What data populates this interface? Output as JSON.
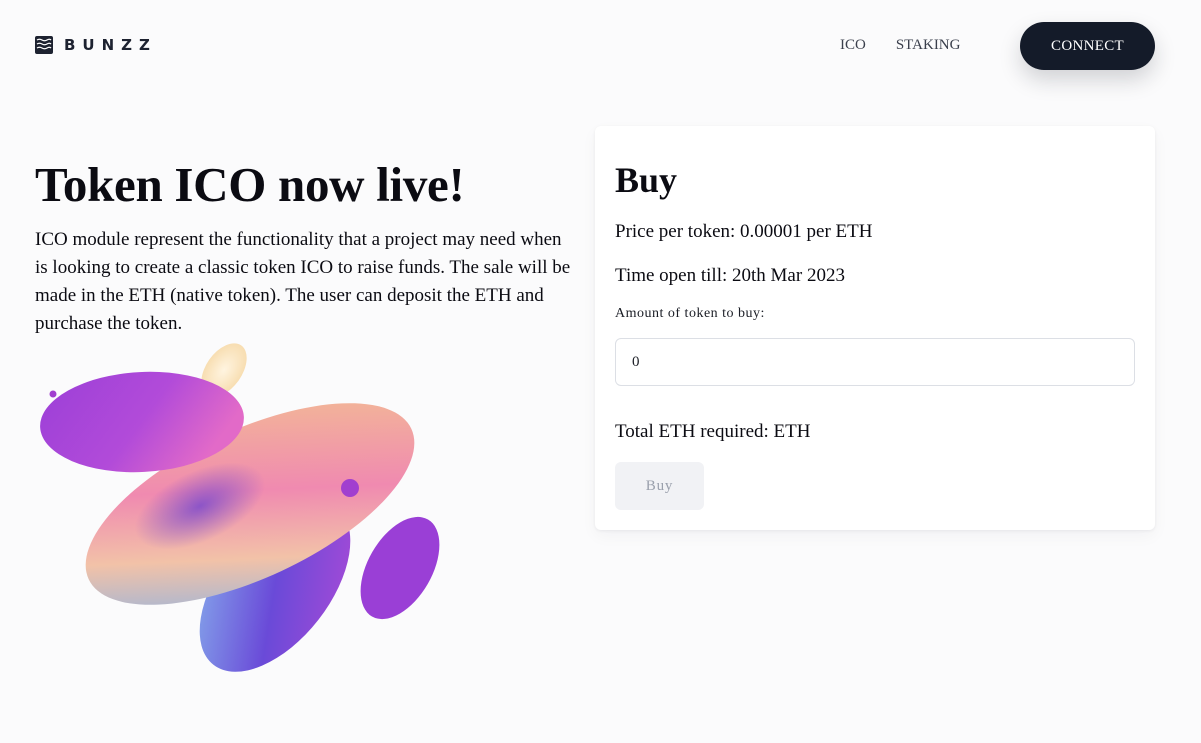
{
  "header": {
    "logo_text": "BUNZZ",
    "logo_icon": "bunzz-logo-icon",
    "nav": [
      {
        "label": "ICO"
      },
      {
        "label": "STAKING"
      }
    ],
    "connect_label": "CONNECT"
  },
  "hero": {
    "title": "Token ICO now live!",
    "description": "ICO module represent the functionality that a project may need when is looking to create a classic token ICO to raise funds. The sale will be made in the ETH (native token). The user can deposit the ETH and purchase the token.",
    "art": "abstract-gradient-shapes"
  },
  "buy_card": {
    "title": "Buy",
    "price_text": "Price per token: 0.00001 per ETH",
    "time_text": "Time open till: 20th Mar 2023",
    "amount_label": "Amount of token to buy:",
    "amount_value": "0",
    "total_text": "Total ETH required: ETH",
    "buy_label": "Buy"
  },
  "colors": {
    "background": "#fbfbfc",
    "connect_button": "#141b29",
    "disabled_button": "#f1f2f5",
    "disabled_text": "#9aa0ac"
  }
}
